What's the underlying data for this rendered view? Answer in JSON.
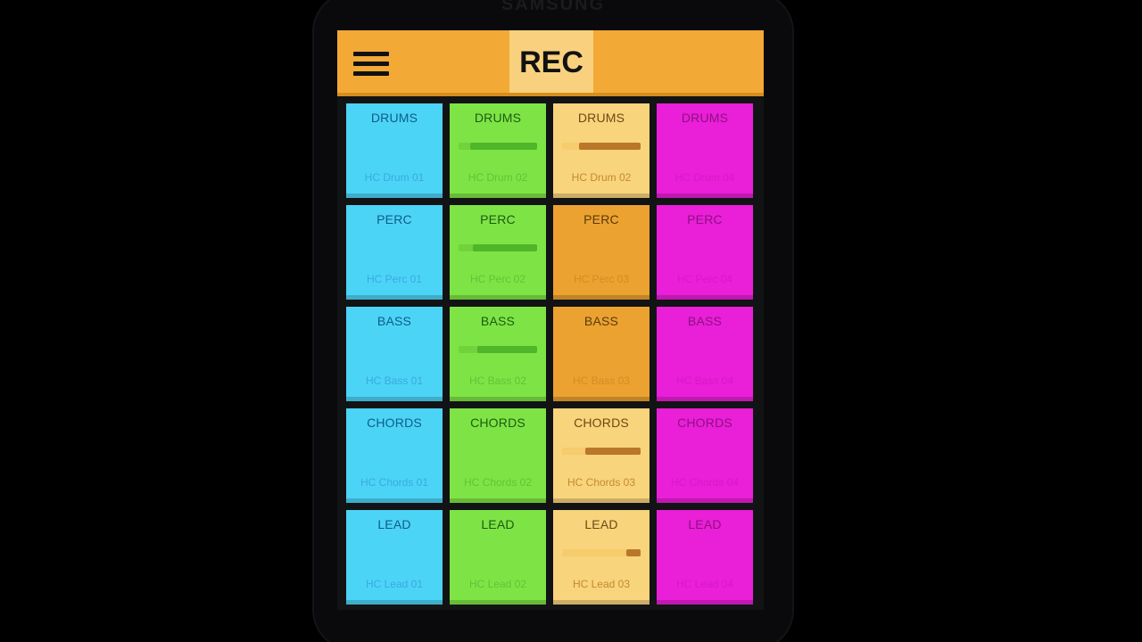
{
  "device": {
    "brand": "SAMSUNG"
  },
  "toolbar": {
    "rec_label": "REC"
  },
  "colors": {
    "blue": "#4cd4f6",
    "green": "#7ee445",
    "gold": "#f8d47c",
    "amber": "#eba230",
    "magenta": "#ea1fd8",
    "topbar": "#f2a936"
  },
  "pads": [
    {
      "title": "DRUMS",
      "sub": "HC Drum 01",
      "color": "blue",
      "level": null
    },
    {
      "title": "DRUMS",
      "sub": "HC Drum 02",
      "color": "green",
      "level": 0.85
    },
    {
      "title": "DRUMS",
      "sub": "HC Drum 02",
      "color": "gold",
      "level": 0.78
    },
    {
      "title": "DRUMS",
      "sub": "HC Drum 04",
      "color": "magenta",
      "level": null
    },
    {
      "title": "PERC",
      "sub": "HC Perc 01",
      "color": "blue",
      "level": null
    },
    {
      "title": "PERC",
      "sub": "HC Perc 02",
      "color": "green",
      "level": 0.82
    },
    {
      "title": "PERC",
      "sub": "HC Perc 03",
      "color": "amber",
      "level": null
    },
    {
      "title": "PERC",
      "sub": "HC Perc 04",
      "color": "magenta",
      "level": null
    },
    {
      "title": "BASS",
      "sub": "HC Bass 01",
      "color": "blue",
      "level": null
    },
    {
      "title": "BASS",
      "sub": "HC Bass 02",
      "color": "green",
      "level": 0.76
    },
    {
      "title": "BASS",
      "sub": "HC Bass 03",
      "color": "amber",
      "level": null
    },
    {
      "title": "BASS",
      "sub": "HC Bass 04",
      "color": "magenta",
      "level": null
    },
    {
      "title": "CHORDS",
      "sub": "HC Chords 01",
      "color": "blue",
      "level": null
    },
    {
      "title": "CHORDS",
      "sub": "HC Chords 02",
      "color": "green",
      "level": null
    },
    {
      "title": "CHORDS",
      "sub": "HC Chords 03",
      "color": "gold",
      "level": 0.7
    },
    {
      "title": "CHORDS",
      "sub": "HC Chords 04",
      "color": "magenta",
      "level": null
    },
    {
      "title": "LEAD",
      "sub": "HC Lead 01",
      "color": "blue",
      "level": null
    },
    {
      "title": "LEAD",
      "sub": "HC Lead 02",
      "color": "green",
      "level": null
    },
    {
      "title": "LEAD",
      "sub": "HC Lead 03",
      "color": "gold",
      "level": 0.18
    },
    {
      "title": "LEAD",
      "sub": "HC Lead 04",
      "color": "magenta",
      "level": null
    }
  ]
}
